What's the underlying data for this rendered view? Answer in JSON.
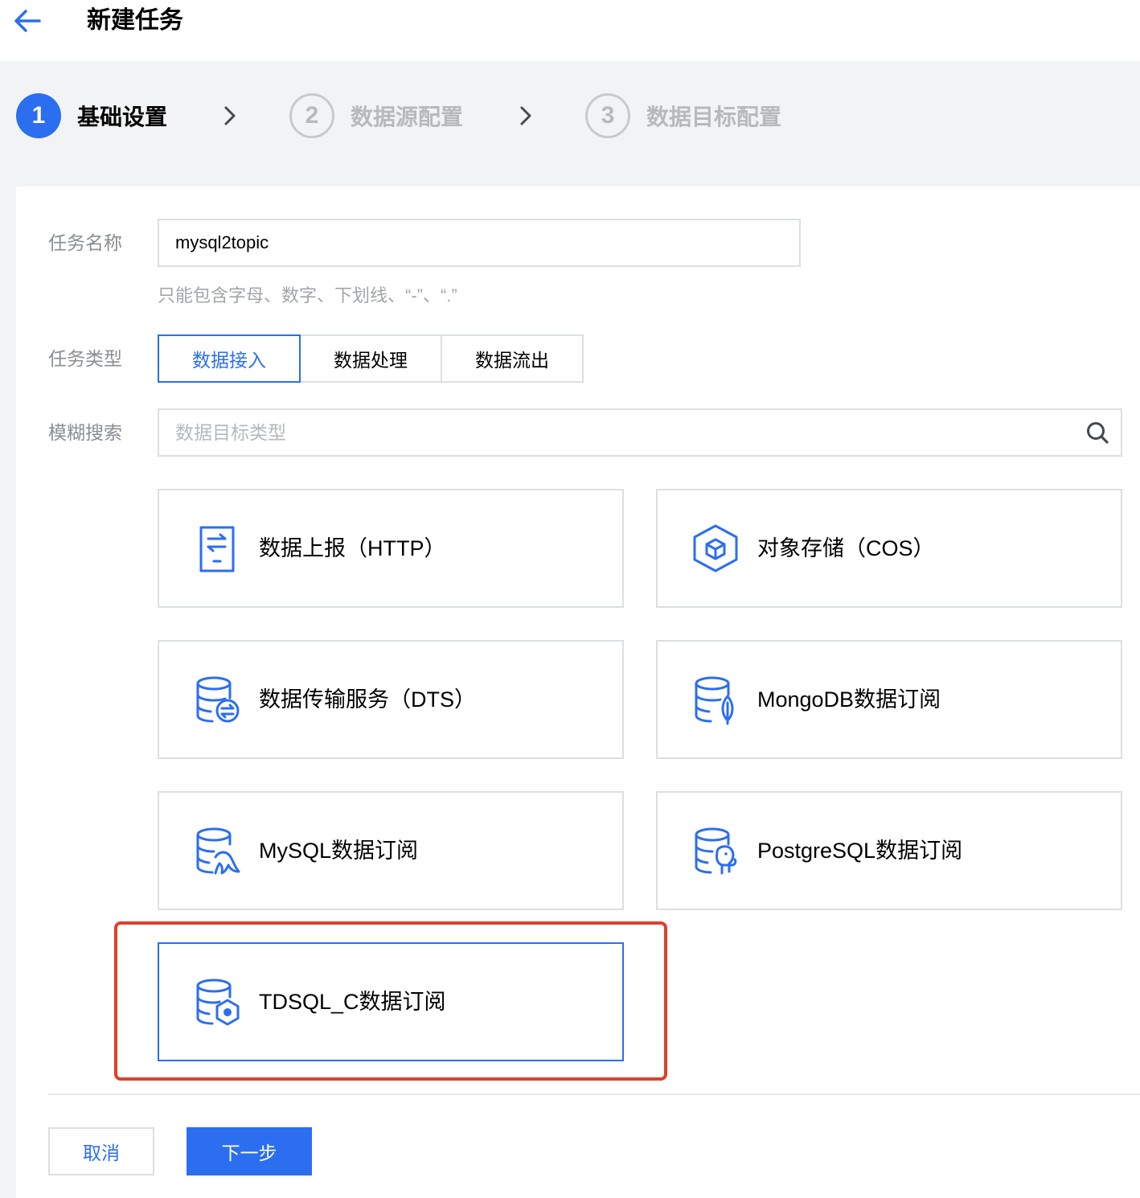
{
  "header": {
    "title": "新建任务",
    "back_icon": "arrow-left-icon"
  },
  "steps": [
    {
      "number": "1",
      "label": "基础设置",
      "state": "active"
    },
    {
      "number": "2",
      "label": "数据源配置",
      "state": "inactive"
    },
    {
      "number": "3",
      "label": "数据目标配置",
      "state": "inactive"
    }
  ],
  "form": {
    "name_label": "任务名称",
    "name_value": "mysql2topic",
    "name_hint": "只能包含字母、数字、下划线、“-”、“.”",
    "type_label": "任务类型",
    "type_options": [
      "数据接入",
      "数据处理",
      "数据流出"
    ],
    "type_selected": "数据接入",
    "search_label": "模糊搜索",
    "search_placeholder": "数据目标类型"
  },
  "tiles": [
    {
      "label": "数据上报（HTTP）",
      "icon": "http-report-icon"
    },
    {
      "label": "对象存储（COS）",
      "icon": "cos-cube-icon"
    },
    {
      "label": "数据传输服务（DTS）",
      "icon": "dts-database-icon"
    },
    {
      "label": "MongoDB数据订阅",
      "icon": "mongodb-database-icon"
    },
    {
      "label": "MySQL数据订阅",
      "icon": "mysql-database-icon"
    },
    {
      "label": "PostgreSQL数据订阅",
      "icon": "postgresql-database-icon"
    },
    {
      "label": "TDSQL_C数据订阅",
      "icon": "tdsql-database-icon",
      "selected": true
    }
  ],
  "footer": {
    "cancel_label": "取消",
    "next_label": "下一步"
  },
  "colors": {
    "accent": "#2b6ef0",
    "highlight": "#e0402b",
    "border": "#dcdfe3",
    "muted_text": "#8a8d92"
  }
}
